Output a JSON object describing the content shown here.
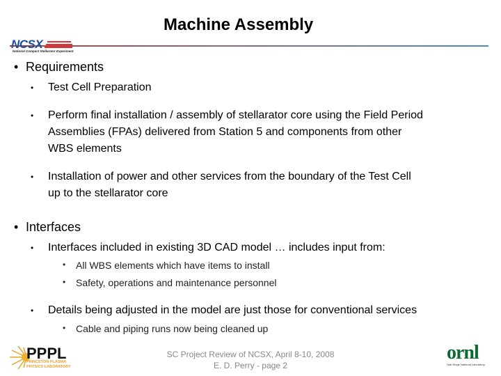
{
  "slide": {
    "title": "Machine Assembly",
    "logos": {
      "top_left": {
        "name": "NCSX",
        "tagline": "National Compact Stellarator Experiment"
      },
      "bottom_left": {
        "name": "PPPL",
        "line1": "PRINCETON PLASMA",
        "line2": "PHYSICS LABORATORY"
      },
      "bottom_right": {
        "name": "ornl",
        "tagline": "Oak Ridge National Laboratory"
      }
    },
    "bullet_char": "•",
    "content": {
      "requirements": {
        "heading": "Requirements",
        "items": [
          {
            "lines": [
              "Test Cell Preparation"
            ]
          },
          {
            "lines": [
              "Perform final installation / assembly of stellarator core using the Field Period",
              "Assemblies (FPAs) delivered from Station 5 and components from other",
              "WBS elements"
            ]
          },
          {
            "lines": [
              "Installation of power and other services from the boundary of the Test Cell",
              "up to the stellarator core"
            ]
          }
        ]
      },
      "interfaces": {
        "heading": "Interfaces",
        "items": [
          {
            "text": "Interfaces included in existing 3D CAD model … includes input from:",
            "subitems": [
              "All WBS elements which have items to install",
              "Safety, operations and maintenance personnel"
            ]
          },
          {
            "text": "Details being adjusted in the model are just those for conventional services",
            "subitems": [
              "Cable and piping runs now being cleaned up"
            ]
          }
        ]
      }
    },
    "footer": {
      "line1": "SC Project Review of NCSX, April 8-10, 2008",
      "line2": "E. D. Perry - page 2"
    },
    "colors": {
      "rule_start": "#c03a3a",
      "rule_end": "#4a8ac8",
      "ncsx_blue": "#1a4fa0",
      "ornl_green": "#0b6a34",
      "pppl_orange": "#e8a22a",
      "footer_gray": "#888888"
    }
  }
}
